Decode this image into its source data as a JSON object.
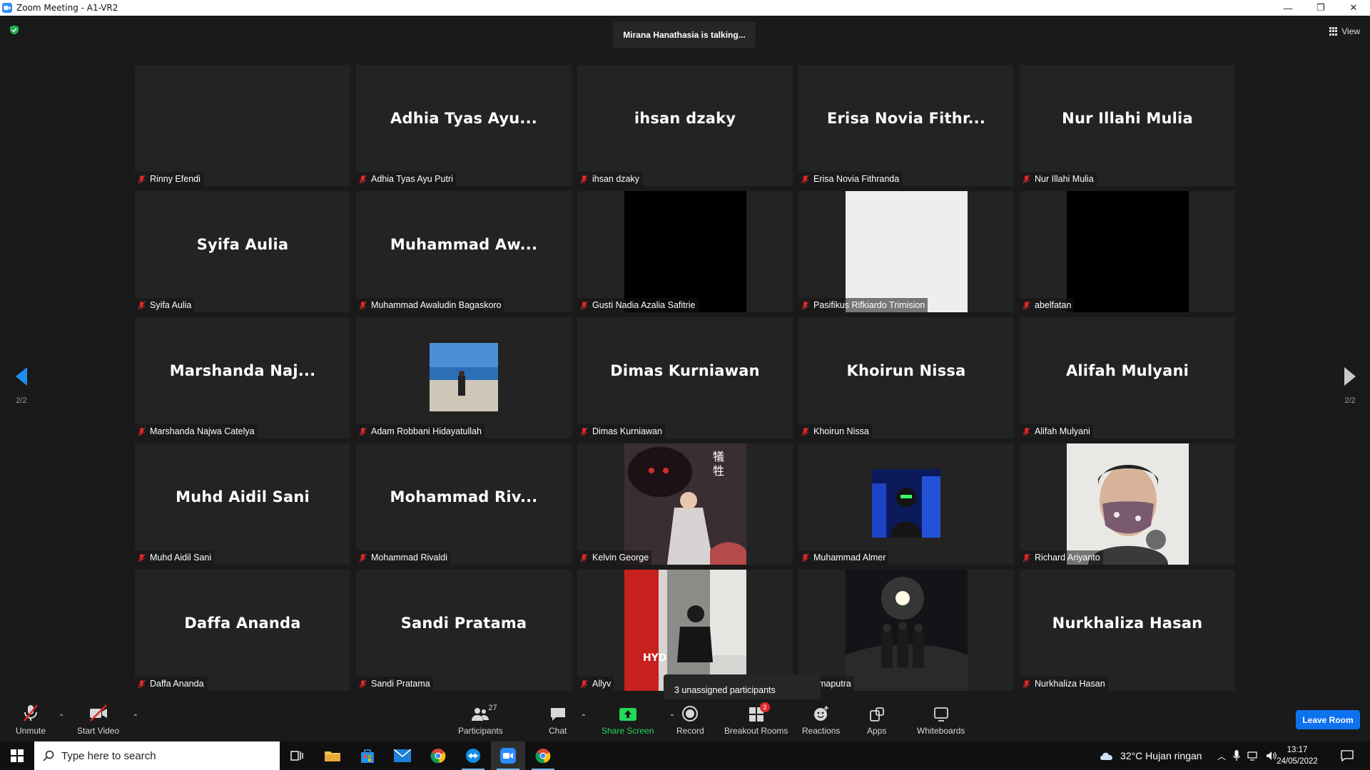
{
  "window": {
    "title": "Zoom Meeting - A1-VR2",
    "minimize": "—",
    "restore": "❐",
    "close": "✕"
  },
  "meeting": {
    "talking_banner": "Mirana Hanathasia is talking...",
    "view_label": "View",
    "page_indicator_left": "2/2",
    "page_indicator_right": "2/2",
    "unassigned_popup": "3 unassigned participants"
  },
  "participants": [
    {
      "big": "",
      "label": "Rinny Efendi",
      "kind": "blank"
    },
    {
      "big": "Adhia  Tyas  Ayu...",
      "label": "Adhia Tyas Ayu Putri",
      "kind": "name"
    },
    {
      "big": "ihsan  dzaky",
      "label": "ihsan dzaky",
      "kind": "name"
    },
    {
      "big": "Erisa  Novia  Fithr...",
      "label": "Erisa Novia Fithranda",
      "kind": "name"
    },
    {
      "big": "Nur  Illahi  Mulia",
      "label": "Nur Illahi Mulia",
      "kind": "name"
    },
    {
      "big": "Syifa  Aulia",
      "label": "Syifa Aulia",
      "kind": "name"
    },
    {
      "big": "Muhammad  Aw...",
      "label": "Muhammad Awaludin Bagaskoro",
      "kind": "name"
    },
    {
      "big": "",
      "label": "Gusti Nadia Azalia Safitrie",
      "kind": "video-black"
    },
    {
      "big": "",
      "label": "Pasifikus Rifkiardo Trimision",
      "kind": "video-white"
    },
    {
      "big": "",
      "label": "abelfatan",
      "kind": "video-black"
    },
    {
      "big": "Marshanda  Naj...",
      "label": "Marshanda Najwa Catelya",
      "kind": "name"
    },
    {
      "big": "",
      "label": "Adam Robbani Hidayatullah",
      "kind": "thumb-beach"
    },
    {
      "big": "Dimas  Kurniawan",
      "label": "Dimas Kurniawan",
      "kind": "name"
    },
    {
      "big": "Khoirun  Nissa",
      "label": "Khoirun Nissa",
      "kind": "name"
    },
    {
      "big": "Alifah  Mulyani",
      "label": "Alifah Mulyani",
      "kind": "name"
    },
    {
      "big": "Muhd  Aidil  Sani",
      "label": "Muhd Aidil Sani",
      "kind": "name"
    },
    {
      "big": "Mohammad  Riv...",
      "label": "Mohammad Rivaldi",
      "kind": "name"
    },
    {
      "big": "",
      "label": "Kelvin George",
      "kind": "video-anime"
    },
    {
      "big": "",
      "label": "Muhammad Almer",
      "kind": "thumb-neon"
    },
    {
      "big": "",
      "label": "Richard Ariyanto",
      "kind": "video-mask"
    },
    {
      "big": "Daffa  Ananda",
      "label": "Daffa Ananda",
      "kind": "name"
    },
    {
      "big": "Sandi  Pratama",
      "label": "Sandi Pratama",
      "kind": "name"
    },
    {
      "big": "",
      "label": "Allyv",
      "kind": "video-red"
    },
    {
      "big": "",
      "label": "amaputra",
      "kind": "video-night"
    },
    {
      "big": "Nurkhaliza  Hasan",
      "label": "Nurkhaliza Hasan",
      "kind": "name"
    }
  ],
  "toolbar": {
    "unmute": "Unmute",
    "start_video": "Start Video",
    "participants": "Participants",
    "participants_count": "27",
    "chat": "Chat",
    "share_screen": "Share Screen",
    "record": "Record",
    "breakout_rooms": "Breakout Rooms",
    "breakout_badge": "3",
    "reactions": "Reactions",
    "apps": "Apps",
    "whiteboards": "Whiteboards",
    "leave_room": "Leave Room"
  },
  "taskbar": {
    "search_placeholder": "Type here to search",
    "weather": "32°C  Hujan ringan",
    "time": "13:17",
    "date": "24/05/2022"
  },
  "colors": {
    "accent": "#0e72ed",
    "share_green": "#23d959",
    "mute_red": "#e02828",
    "tile_bg": "#232323"
  }
}
